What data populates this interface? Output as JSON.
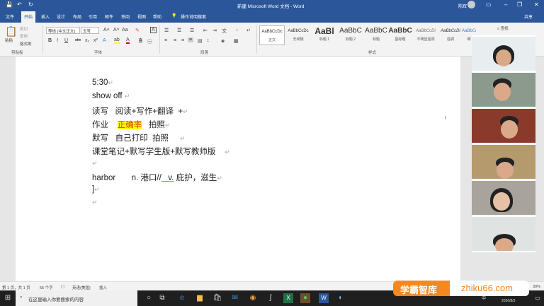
{
  "titlebar": {
    "title": "新建 Microsoft Word 文档 - Word",
    "user": "陈辉",
    "share": "共享"
  },
  "tabs": [
    "文件",
    "开始",
    "插入",
    "设计",
    "布局",
    "引用",
    "邮件",
    "审阅",
    "视图",
    "帮助"
  ],
  "tell_me": "操作说明搜索",
  "ribbon": {
    "clipboard": {
      "paste": "粘贴",
      "cut": "剪切",
      "copy": "复制",
      "format_painter": "格式刷",
      "group": "剪贴板"
    },
    "font": {
      "name": "等线 (中文正文)",
      "size": "五号",
      "group": "字体"
    },
    "paragraph": {
      "group": "段落"
    },
    "styles": {
      "group": "样式",
      "items": [
        {
          "preview": "AaBbCcDc",
          "name": "正文"
        },
        {
          "preview": "AaBbCcDc",
          "name": "无间隔"
        },
        {
          "preview": "AaBl",
          "name": "标题 1"
        },
        {
          "preview": "AaBbC",
          "name": "标题 2"
        },
        {
          "preview": "AaBbC",
          "name": "标题"
        },
        {
          "preview": "AaBbC",
          "name": "副标题"
        },
        {
          "preview": "AaBbCcDi",
          "name": "不明显强调"
        },
        {
          "preview": "AaBbCcDi",
          "name": "强调"
        },
        {
          "preview": "AaBbCcDi",
          "name": "明"
        }
      ]
    },
    "editing": {
      "find": "查找"
    }
  },
  "document": {
    "lines": [
      "5:30",
      "show off",
      "读写   阅读+写作+翻译  +",
      "作业",
      "正确率",
      "拍照",
      "默写   自己打印  拍照",
      "课堂笔记+默写学生版+默写教师版",
      "",
      "harbor",
      "n. 港口//",
      "v.",
      "庇护，滋生",
      "]"
    ]
  },
  "status": {
    "page": "第 1 页，共 1 页",
    "words": "56 个字",
    "lang": "英语(美国)",
    "mode": "插入",
    "zoom": "30%"
  },
  "taskbar": {
    "search_placeholder": "在这里输入你要搜索的内容",
    "date": "2020/8/3",
    "ime": "中"
  },
  "watermark": {
    "cn": "学霸智库",
    "url": "zhiku66.com"
  }
}
